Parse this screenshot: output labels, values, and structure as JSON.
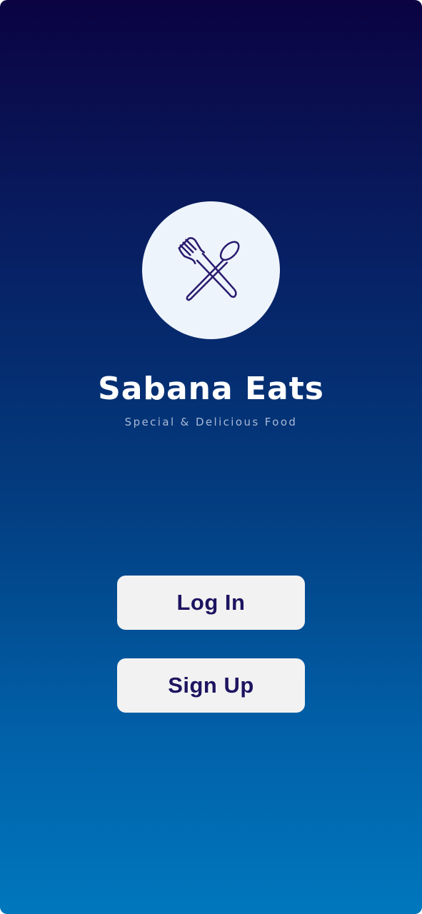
{
  "app": {
    "title": "Sabana Eats",
    "tagline": "Special & Delicious Food",
    "logo_icon": "fork-and-spoon-icon"
  },
  "actions": {
    "login_label": "Log In",
    "signup_label": "Sign Up"
  },
  "colors": {
    "gradient_top": "#0b0342",
    "gradient_bottom": "#0077bd",
    "button_background": "#f2f2f2",
    "button_text": "#1d1460",
    "logo_circle": "#eef4fb",
    "icon_stroke": "#2a1a6e"
  }
}
